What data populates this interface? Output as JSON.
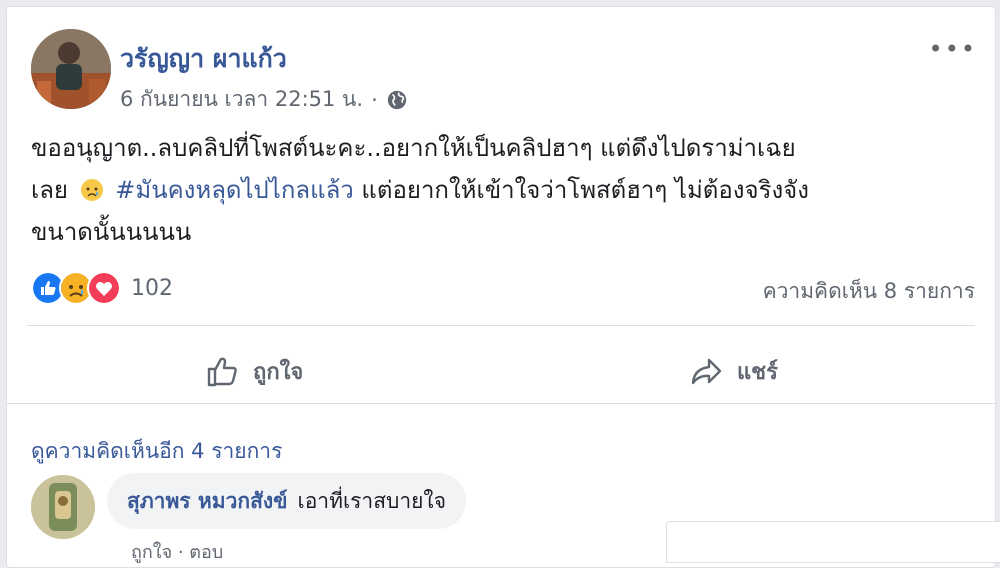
{
  "post": {
    "author": "วรัญญา ผาแก้ว",
    "date": "6 กันยายน เวลา 22:51 น.",
    "dot": "·",
    "privacy_icon": "globe-icon",
    "more_label": "•••",
    "text_line1": "ขออนุญาต..ลบคลิปที่โพสต์นะคะ..อยากให้เป็นคลิปฮาๆ แต่ดึงไปดราม่าเฉย",
    "text_line2_before": "เลย",
    "text_line2_emoji": "sad-emoji",
    "hashtag": "#มันคงหลุดไปไกลแล้ว",
    "text_line2_after": "แต่อยากให้เข้าใจว่าโพสต์ฮาๆ ไม่ต้องจริงจัง",
    "text_line3": "ขนาดนั้นนนนน"
  },
  "reactions": {
    "icons": [
      "like-icon",
      "sad-icon",
      "love-icon"
    ],
    "count": "102",
    "comments_count": "ความคิดเห็น 8 รายการ"
  },
  "actions": {
    "like_label": "ถูกใจ",
    "share_label": "แชร์"
  },
  "comments": {
    "see_more": "ดูความคิดเห็นอีก 4 รายการ",
    "items": [
      {
        "name": "สุภาพร หมวกสังข์",
        "text": "เอาที่เราสบายใจ",
        "meta": "ถูกใจ · ตอบ"
      }
    ]
  },
  "colors": {
    "link": "#385898",
    "like_blue": "#1877f2",
    "love_red": "#f33e58",
    "sad_yellow": "#f7b125"
  }
}
